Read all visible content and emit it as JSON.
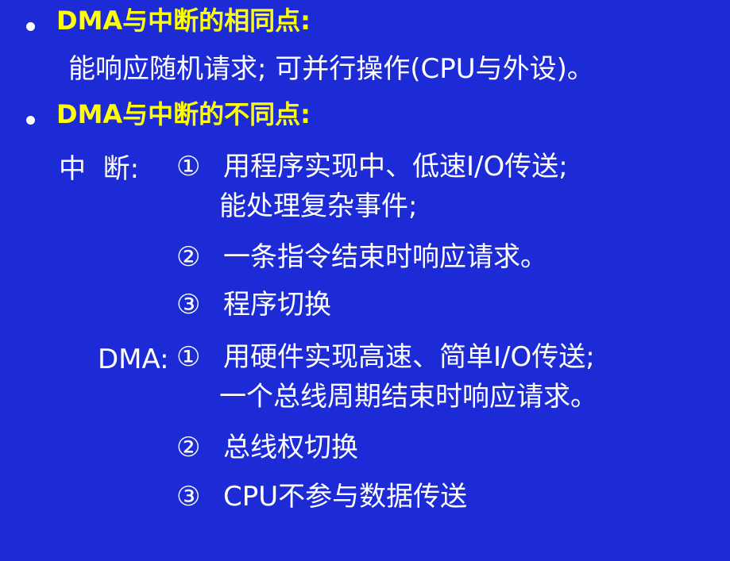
{
  "heading1": "DMA与中断的相同点:",
  "same_point_text": "能响应随机请求; 可并行操作(CPU与外设)。",
  "heading2": "DMA与中断的不同点:",
  "interrupt": {
    "label": "中  断:",
    "items": [
      {
        "marker": "①",
        "lines": [
          "用程序实现中、低速I/O传送;",
          "能处理复杂事件;"
        ]
      },
      {
        "marker": "②",
        "lines": [
          "一条指令结束时响应请求。"
        ]
      },
      {
        "marker": "③",
        "lines": [
          "程序切换"
        ]
      }
    ]
  },
  "dma": {
    "label": "DMA:",
    "items": [
      {
        "marker": "①",
        "lines": [
          "用硬件实现高速、简单I/O传送;",
          "一个总线周期结束时响应请求。"
        ]
      },
      {
        "marker": "②",
        "lines": [
          "总线权切换"
        ]
      },
      {
        "marker": "③",
        "lines": [
          "CPU不参与数据传送"
        ]
      }
    ]
  },
  "colors": {
    "background": "#1c2bd6",
    "heading": "#ffff00",
    "text": "#ffffff"
  }
}
